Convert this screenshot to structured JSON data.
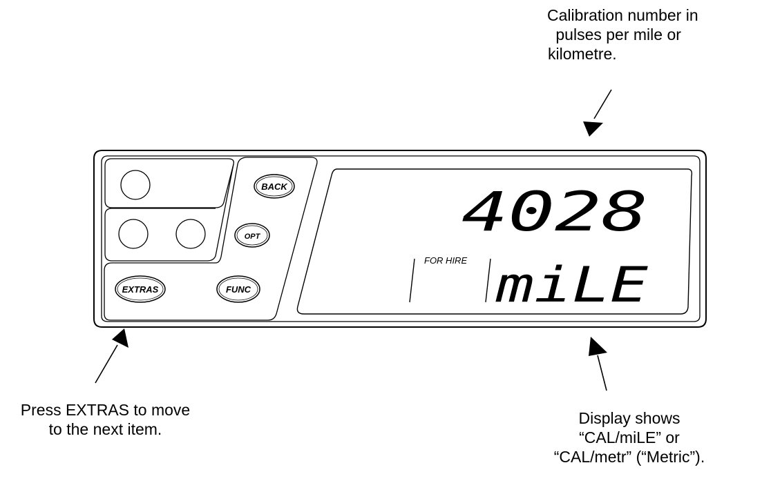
{
  "annotations": {
    "calibration": [
      "Calibration number in",
      " pulses per mile or",
      "kilometre."
    ],
    "extras": [
      "Press EXTRAS to move",
      "to the next item."
    ],
    "display": [
      "Display shows",
      "“CAL/miLE” or",
      "“CAL/metr” (“Metric”)."
    ]
  },
  "buttons": {
    "back": "BACK",
    "opt": "OPT",
    "extras": "EXTRAS",
    "func": "FUNC"
  },
  "display": {
    "top_value": "4028",
    "status_label": "FOR HIRE",
    "bottom_value": "miLE"
  }
}
